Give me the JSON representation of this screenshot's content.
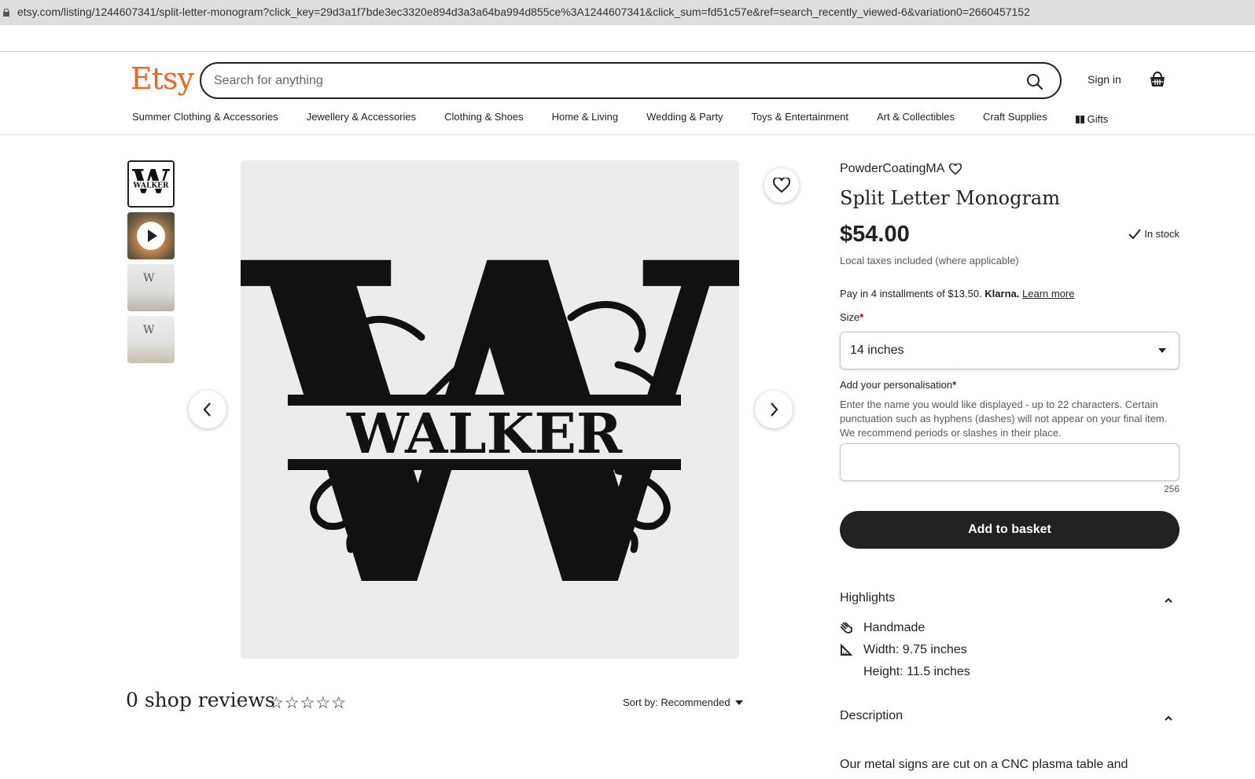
{
  "browser": {
    "url": "etsy.com/listing/1244607341/split-letter-monogram?click_key=29d3a1f7bde3ec3320e894d3a3a64ba994d855ce%3A1244607341&click_sum=fd51c57e&ref=search_recently_viewed-6&variation0=2660457152"
  },
  "header": {
    "logo": "Etsy",
    "search_placeholder": "Search for anything",
    "sign_in": "Sign in"
  },
  "nav": {
    "items": [
      "Summer Clothing & Accessories",
      "Jewellery & Accessories",
      "Clothing & Shoes",
      "Home & Living",
      "Wedding & Party",
      "Toys & Entertainment",
      "Art & Collectibles",
      "Craft Supplies"
    ],
    "gifts": "Gifts"
  },
  "gallery": {
    "main_letter": "W",
    "main_name": "WALKER",
    "thumb_letter": "W",
    "thumb_name": "WALKER"
  },
  "reviews": {
    "title": "0 shop reviews",
    "stars": "☆☆☆☆☆",
    "sort_label": "Sort by: Recommended"
  },
  "product": {
    "shop_name": "PowderCoatingMA",
    "title": "Split Letter Monogram",
    "price": "$54.00",
    "stock": "In stock",
    "taxes": "Local taxes included (where applicable)",
    "klarna_text": "Pay in 4 installments of $13.50.",
    "klarna_brand": "Klarna.",
    "klarna_link": "Learn more",
    "size_label": "Size",
    "size_value": "14 inches",
    "required_mark": "*",
    "personalisation_label": "Add your personalisation",
    "personalisation_desc": "Enter the name you would like displayed - up to 22 characters. Certain punctuation such as hyphens (dashes) will not appear on your final item. We recommend periods or slashes in their place.",
    "char_count": "256",
    "add_to_basket": "Add to basket"
  },
  "highlights": {
    "title": "Highlights",
    "handmade": "Handmade",
    "width": "Width: 9.75 inches",
    "height": "Height: 11.5 inches"
  },
  "description": {
    "title": "Description",
    "text": "Our metal signs are cut on a CNC plasma table and"
  }
}
